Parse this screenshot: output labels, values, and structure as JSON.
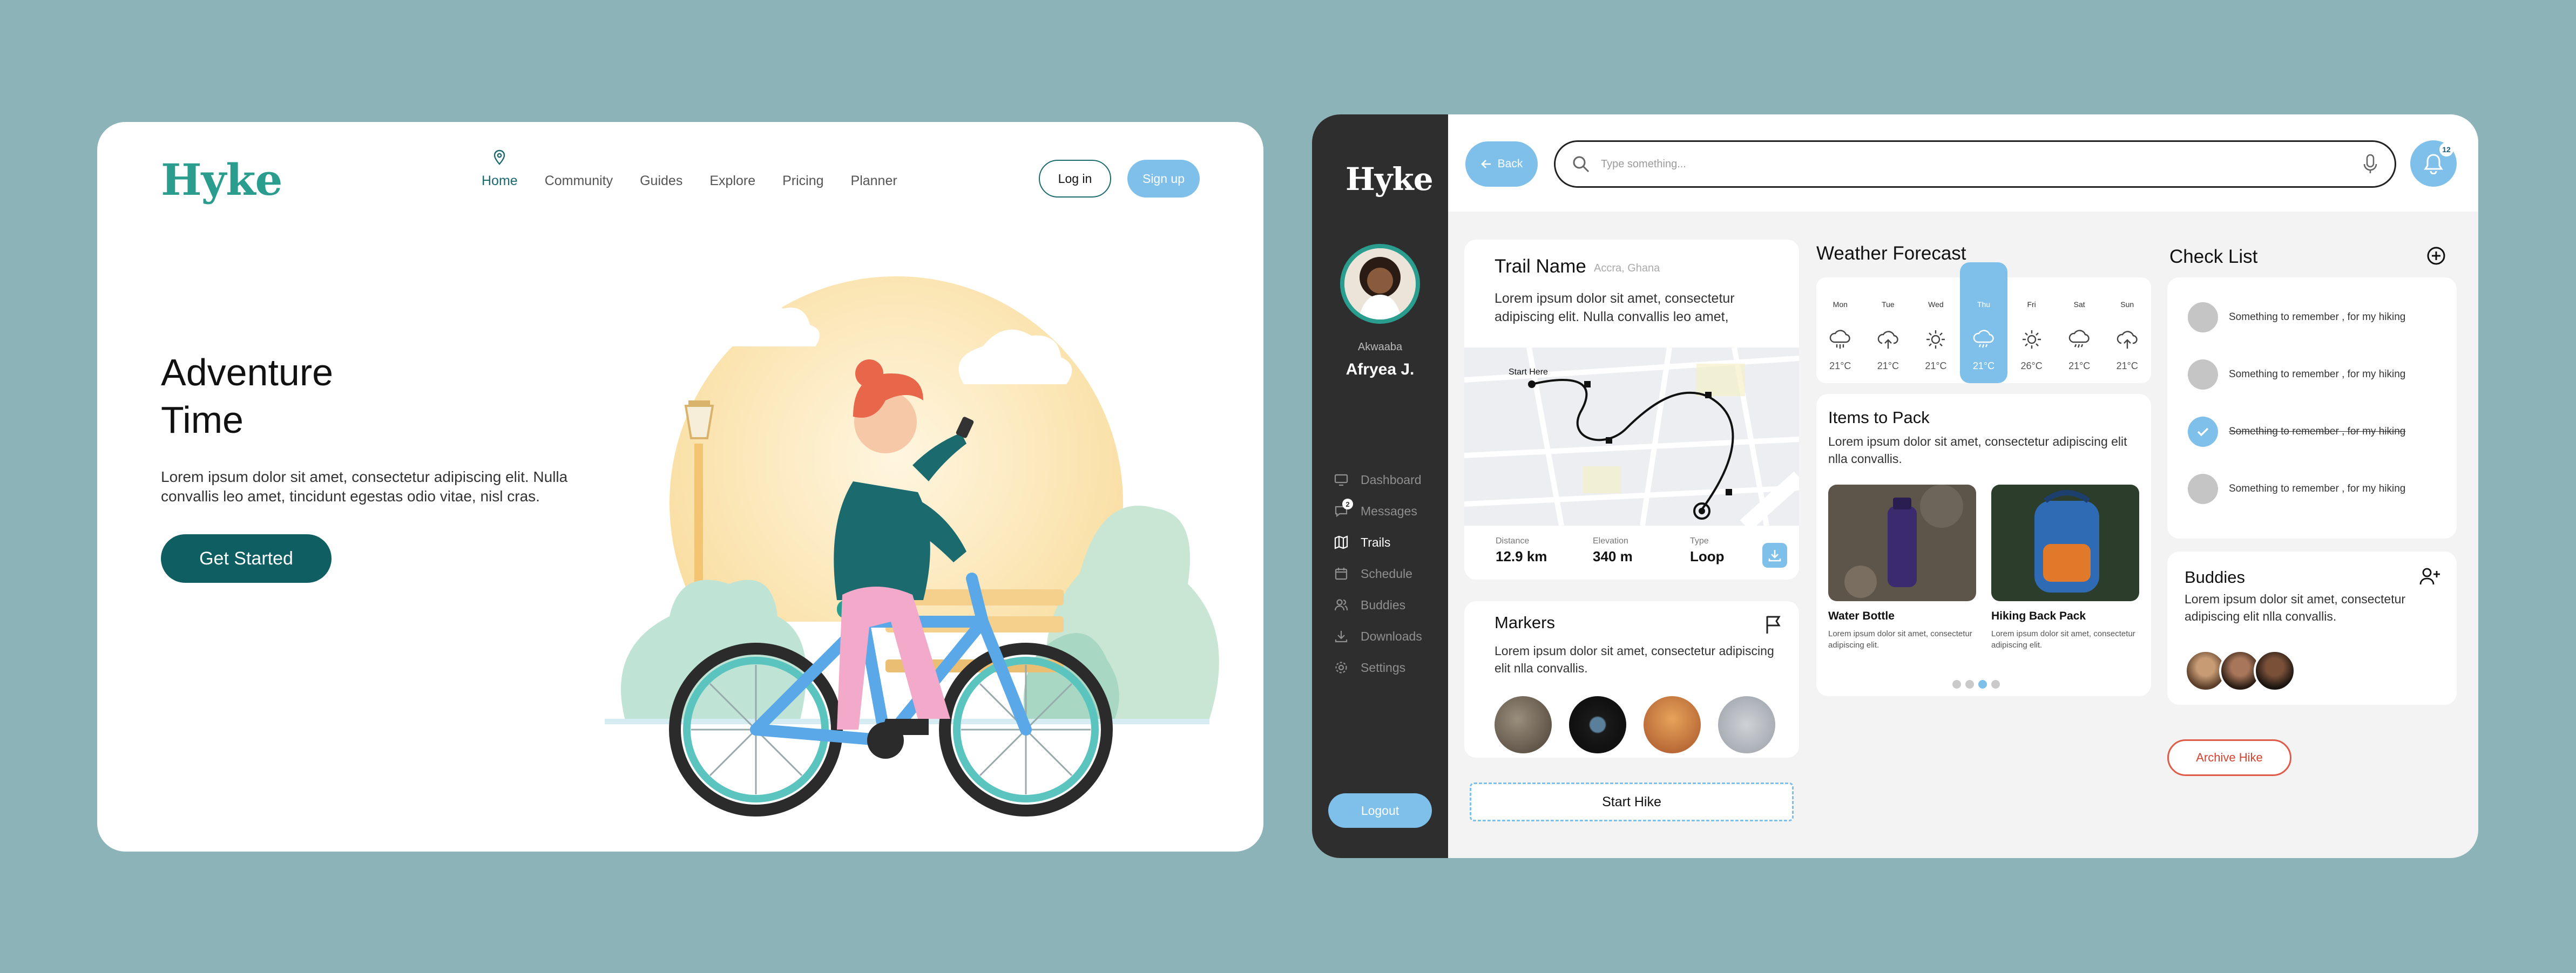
{
  "landing": {
    "logo": "Hyke",
    "nav": [
      "Home",
      "Community",
      "Guides",
      "Explore",
      "Pricing",
      "Planner"
    ],
    "login_label": "Log in",
    "signup_label": "Sign up",
    "hero_title_line1": "Adventure",
    "hero_title_line2": "Time",
    "hero_text": "Lorem ipsum dolor sit amet, consectetur adipiscing elit. Nulla convallis leo amet, tincidunt egestas odio vitae, nisl cras.",
    "cta_label": "Get Started"
  },
  "dashboard": {
    "logo": "Hyke",
    "greeting": "Akwaaba",
    "user_name": "Afryea J.",
    "menu": [
      {
        "label": "Dashboard",
        "icon": "monitor-icon"
      },
      {
        "label": "Messages",
        "icon": "message-icon",
        "badge": "2"
      },
      {
        "label": "Trails",
        "icon": "map-icon",
        "active": true
      },
      {
        "label": "Schedule",
        "icon": "calendar-icon"
      },
      {
        "label": "Buddies",
        "icon": "users-icon"
      },
      {
        "label": "Downloads",
        "icon": "download-icon"
      },
      {
        "label": "Settings",
        "icon": "gear-icon"
      }
    ],
    "logout_label": "Logout",
    "back_label": "Back",
    "search_placeholder": "Type something...",
    "notification_count": "12",
    "trail": {
      "title": "Trail Name",
      "location": "Accra, Ghana",
      "description": "Lorem ipsum dolor sit amet, consectetur adipiscing elit. Nulla convallis leo amet,",
      "map_start_label": "Start Here",
      "stats": [
        {
          "label": "Distance",
          "value": "12.9 km"
        },
        {
          "label": "Elevation",
          "value": "340 m"
        },
        {
          "label": "Type",
          "value": "Loop"
        }
      ]
    },
    "markers": {
      "title": "Markers",
      "description": "Lorem ipsum dolor sit amet, consectetur adipiscing elit nlla convallis."
    },
    "start_hike_label": "Start Hike",
    "weather": {
      "title": "Weather Forecast",
      "days": [
        {
          "day": "Mon",
          "temp": "21°C",
          "icon": "rain-icon"
        },
        {
          "day": "Tue",
          "temp": "21°C",
          "icon": "cloud-up-icon"
        },
        {
          "day": "Wed",
          "temp": "21°C",
          "icon": "sun-icon"
        },
        {
          "day": "Thu",
          "temp": "21°C",
          "icon": "cloud-rain-icon",
          "selected": true
        },
        {
          "day": "Fri",
          "temp": "26°C",
          "icon": "sun-icon"
        },
        {
          "day": "Sat",
          "temp": "21°C",
          "icon": "cloud-rain-icon"
        },
        {
          "day": "Sun",
          "temp": "21°C",
          "icon": "cloud-up-icon"
        }
      ]
    },
    "items": {
      "title": "Items to Pack",
      "description": "Lorem ipsum dolor sit amet, consectetur adipiscing elit nlla convallis.",
      "list": [
        {
          "name": "Water Bottle",
          "desc": "Lorem ipsum dolor sit amet, consectetur adipiscing elit."
        },
        {
          "name": "Hiking Back Pack",
          "desc": "Lorem ipsum dolor sit amet, consectetur adipiscing elit."
        }
      ]
    },
    "checklist": {
      "title": "Check List",
      "items": [
        {
          "text": "Something to remember ,  for my hiking",
          "done": false
        },
        {
          "text": "Something to remember ,  for my hiking",
          "done": false
        },
        {
          "text": "Something to remember ,  for my hiking",
          "done": true
        },
        {
          "text": "Something to remember ,  for my hiking",
          "done": false
        }
      ]
    },
    "buddies": {
      "title": "Buddies",
      "description": "Lorem ipsum dolor sit amet, consectetur adipiscing elit nlla convallis."
    },
    "archive_label": "Archive Hike"
  },
  "colors": {
    "background": "#8cb4b8",
    "brand_teal": "#2a9d8f",
    "accent_blue": "#7ec0ea",
    "dark_teal": "#0e5e62",
    "sidebar": "#2e2e2e",
    "archive_red": "#d6402e"
  }
}
